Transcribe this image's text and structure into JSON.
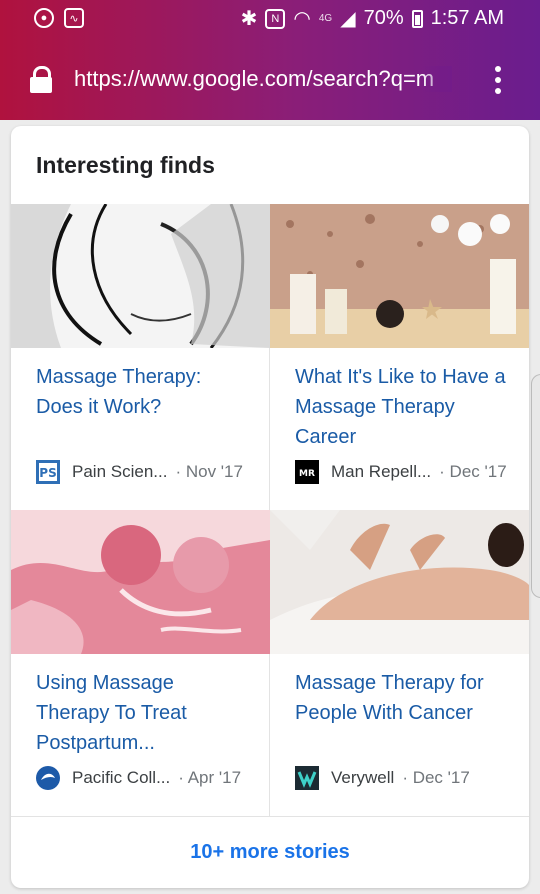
{
  "status_bar": {
    "network": "4G",
    "battery": "70%",
    "time": "1:57 AM"
  },
  "browser": {
    "url": "https://www.google.com/search?q=m"
  },
  "card": {
    "heading": "Interesting finds",
    "articles": [
      {
        "title": "Massage Therapy: Does it Work?",
        "source": "Pain Scien...",
        "date": "· Nov '17"
      },
      {
        "title": "What It's Like to Have a Massage Therapy Career",
        "source": "Man Repell...",
        "date": "· Dec '17"
      },
      {
        "title": "Using Massage Therapy To Treat Postpartum...",
        "source": "Pacific Coll...",
        "date": "· Apr '17"
      },
      {
        "title": "Massage Therapy for People With Cancer",
        "source": "Verywell",
        "date": "· Dec '17"
      }
    ],
    "more_label": "10+ more stories"
  },
  "colors": {
    "link": "#1a5ba6",
    "more": "#1a73e8",
    "topbar_start": "#b0123e",
    "topbar_end": "#6a1d8e"
  },
  "icons": [
    "firefox-icon",
    "activity-icon",
    "bluetooth-icon",
    "nfc-icon",
    "wifi-icon",
    "signal-icon",
    "battery-icon",
    "lock-icon",
    "overflow-menu-icon"
  ]
}
